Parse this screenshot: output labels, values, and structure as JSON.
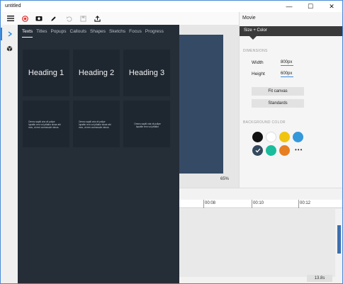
{
  "window": {
    "title": "untitled",
    "controls": {
      "minimize": "—",
      "maximize": "☐",
      "close": "✕"
    }
  },
  "rail": {
    "items": [
      {
        "icon": "chevron-right-icon",
        "active": true
      },
      {
        "icon": "cube-icon",
        "active": false
      }
    ]
  },
  "toolbar": {
    "buttons": [
      "menu-icon",
      "record-icon",
      "camera-icon",
      "pen-icon",
      "undo-icon",
      "save-icon",
      "export-icon"
    ]
  },
  "canvas": {
    "zoom": "65%"
  },
  "overlay": {
    "tabs": [
      "Texts",
      "Titles",
      "Popups",
      "Callouts",
      "Shapes",
      "Sketchs",
      "Focus",
      "Progress"
    ],
    "active_tab": "Texts",
    "cards": [
      {
        "kind": "heading",
        "text": "Heading 1"
      },
      {
        "kind": "heading",
        "text": "Heading 2"
      },
      {
        "kind": "heading",
        "text": "Heading 3"
      },
      {
        "kind": "paragraph",
        "text": "Ommo sapiti oria vit polipe lupatiin rero vol ptlatiur sinae abi mos, ut rem conmosole nimus."
      },
      {
        "kind": "paragraph",
        "text": "Ommo sapiti oria vit polipe lupatiin rero vol ptlatiur sinae abi mos, ut rem conmosole nimus."
      },
      {
        "kind": "paragraph-small",
        "text": "Ommo sapiti oria vit polipe lupatiin rero vol ptlatiur"
      }
    ]
  },
  "panel": {
    "title": "Movie",
    "section": "Size + Color",
    "dimensions_label": "DIMENSIONS",
    "width_label": "Width",
    "width_value": "800px",
    "height_label": "Height",
    "height_value": "600px",
    "fit_canvas": "Fit canvas",
    "standards": "Standards",
    "bg_label": "BACKGROUND COLOR",
    "swatches": [
      "#111111",
      "#ffffff",
      "#f1c40f",
      "#3498db",
      "#34495e",
      "#1abc9c",
      "#e67e22"
    ],
    "selected_swatch": 4,
    "more": "•••"
  },
  "timeline": {
    "ticks": [
      "00:08",
      "00:10",
      "00:12"
    ],
    "duration": "13.8s"
  }
}
